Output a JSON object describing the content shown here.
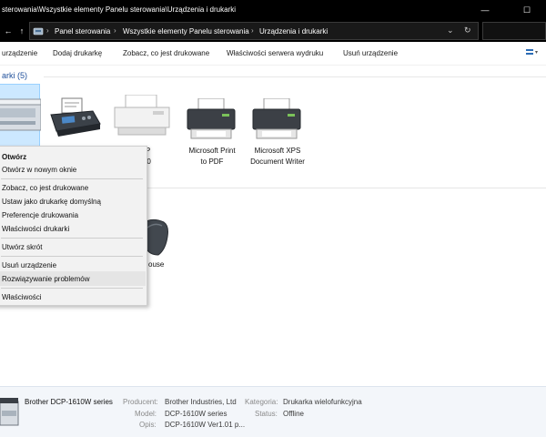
{
  "window": {
    "title": "sterowania\\Wszystkie elementy Panelu sterowania\\Urządzenia i drukarki",
    "min_glyph": "—",
    "max_glyph": "☐"
  },
  "address": {
    "back_glyph": "←",
    "up_glyph": "↑",
    "segments": [
      "Panel sterowania",
      "Wszystkie elementy Panelu sterowania",
      "Urządzenia i drukarki"
    ],
    "sep_glyph": "›",
    "dropdown_glyph": "⌄",
    "refresh_glyph": "↻"
  },
  "commands": [
    "urządzenie",
    "Dodaj drukarkę",
    "Zobacz, co jest drukowane",
    "Właściwości serwera wydruku",
    "Usuń urządzenie"
  ],
  "group": {
    "title": "arki (5)"
  },
  "devices": [
    {
      "label": "",
      "icon": "all-in-one-printer-icon"
    },
    {
      "label": "",
      "icon": "fax-icon"
    },
    {
      "label": "5 (HP\nt 8110\ns)",
      "icon": "inkjet-printer-icon"
    },
    {
      "label": "Microsoft Print\nto PDF",
      "icon": "virtual-printer-icon"
    },
    {
      "label": "Microsoft XPS\nDocument Writer",
      "icon": "virtual-printer-icon"
    }
  ],
  "context_menu": {
    "items": [
      "Otwórz",
      "Otwórz w nowym oknie",
      "Zobacz, co jest drukowane",
      "Ustaw jako drukarkę domyślną",
      "Preferencje drukowania",
      "Właściwości drukarki",
      "Utwórz skrót",
      "Usuń urządzenie",
      "Rozwiązywanie problemów",
      "Właściwości"
    ]
  },
  "other_devices": {
    "mouse_label": "ouse"
  },
  "details": {
    "name": "Brother DCP-1610W series",
    "labels": {
      "producer": "Producent:",
      "model": "Model:",
      "description": "Opis:",
      "category": "Kategoria:",
      "status": "Status:"
    },
    "values": {
      "producer": "Brother Industries, Ltd",
      "model": "DCP-1610W series",
      "description": "DCP-1610W Ver1.01 p...",
      "category": "Drukarka wielofunkcyjna",
      "status": "Offline"
    }
  },
  "colors": {
    "selection_bg": "#cce8ff",
    "selection_border": "#99d1ff",
    "group_title": "#1e4e9a",
    "titlebar_bg": "#000000"
  }
}
